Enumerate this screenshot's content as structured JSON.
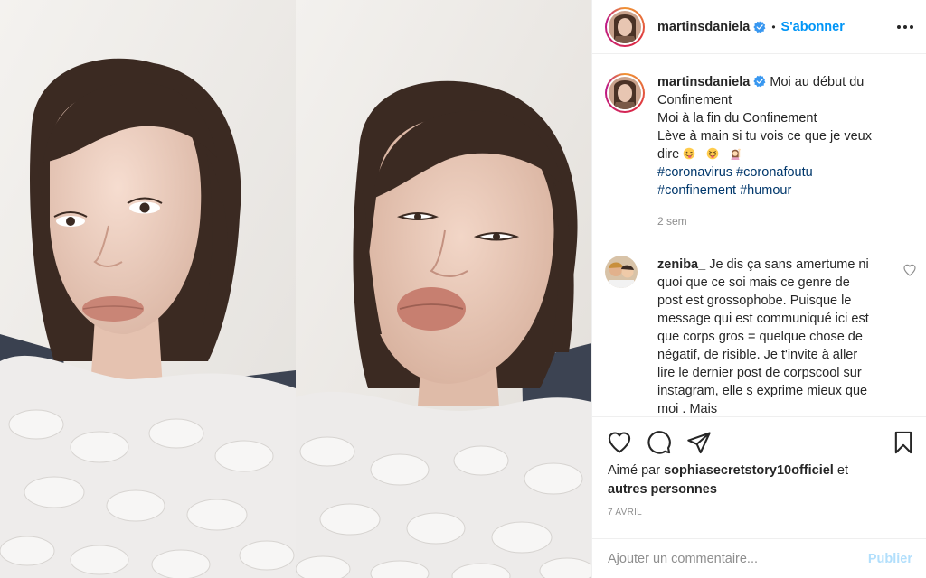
{
  "post": {
    "username": "martinsdaniela",
    "follow_label": "S'abonner",
    "dot": "•",
    "caption_lines": [
      "Moi au début du",
      "Confinement",
      "Moi à la fin du Confinement",
      "Lève à main si tu vois ce que je veux",
      "dire"
    ],
    "caption_emojis": [
      "winking-tongue-emoji",
      "squinting-tongue-emoji",
      "woman-raising-hand-emoji"
    ],
    "hashtags": [
      "#coronavirus",
      "#coronafoutu",
      "#confinement",
      "#humour"
    ],
    "time_ago": "2 sem"
  },
  "comment": {
    "username": "zeniba_",
    "text": "Je dis ça sans amertume ni quoi que ce soi mais ce genre de post est grossophobe. Puisque le message qui est communiqué ici est que corps gros = quelque chose de négatif, de risible. Je t'invite à aller lire le dernier post de corpscool sur instagram, elle s exprime mieux que moi . Mais"
  },
  "likes": {
    "prefix": "Aimé par",
    "user": "sophiasecretstory10officiel",
    "connector": "et",
    "others": "autres personnes"
  },
  "date": "7 AVRIL",
  "add_comment": {
    "placeholder": "Ajouter un commentaire...",
    "publish_label": "Publier"
  },
  "colors": {
    "accent": "#0095f6",
    "publish_disabled": "#b2dffc",
    "hashtag": "#00376b",
    "muted": "#8e8e8e",
    "verified": "#3897f0"
  },
  "icons": [
    "more-options-icon",
    "verified-badge-icon",
    "heart-icon",
    "comment-icon",
    "share-icon",
    "bookmark-icon"
  ]
}
